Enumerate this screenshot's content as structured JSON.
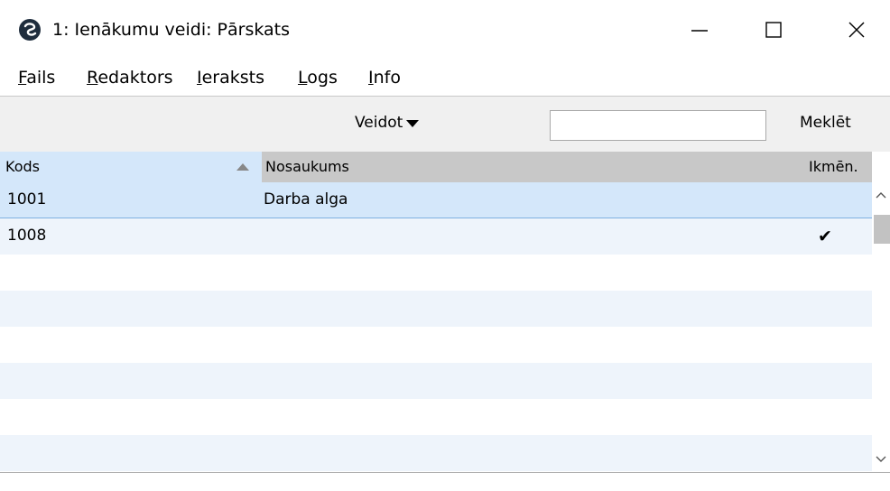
{
  "window": {
    "title": "1: Ienākumu veidi: Pārskats",
    "icon": "app-logo-icon"
  },
  "menu": {
    "items": [
      {
        "label": "Fails"
      },
      {
        "label": "Redaktors"
      },
      {
        "label": "Ieraksts"
      },
      {
        "label": "Logs"
      },
      {
        "label": "Info"
      }
    ]
  },
  "toolbar": {
    "create_label": "Veidot",
    "search_value": "",
    "search_label": "Meklēt"
  },
  "table": {
    "columns": [
      "Kods",
      "Nosaukums",
      "Ikmēn."
    ],
    "sort_column": "Kods",
    "sort_direction": "ascending",
    "rows": [
      {
        "code": "1001",
        "name": "Darba alga",
        "monthly": ""
      },
      {
        "code": "1008",
        "name": "",
        "monthly": "✔"
      }
    ]
  },
  "colors": {
    "selection": "#d4e7fa",
    "header_gray": "#c8c8c8",
    "toolbar_bg": "#f0f0f0"
  }
}
